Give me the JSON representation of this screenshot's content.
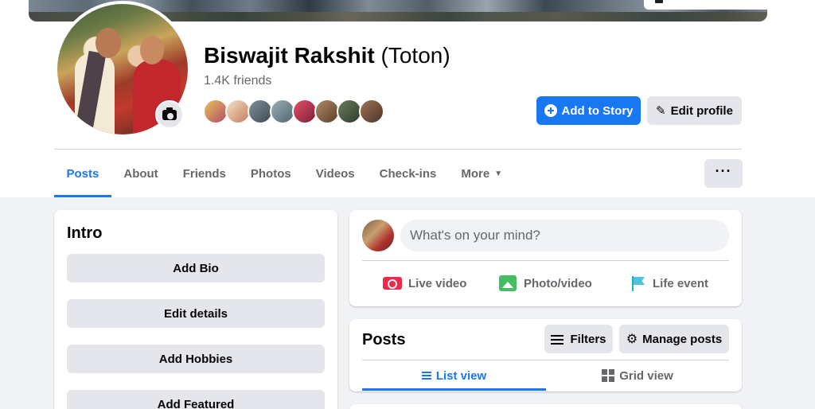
{
  "profile": {
    "name": "Biswajit Rakshit",
    "nickname": "(Toton)",
    "friends_count": "1.4K friends"
  },
  "actions": {
    "add_story": "Add to Story",
    "edit_profile": "Edit profile"
  },
  "tabs": [
    {
      "label": "Posts"
    },
    {
      "label": "About"
    },
    {
      "label": "Friends"
    },
    {
      "label": "Photos"
    },
    {
      "label": "Videos"
    },
    {
      "label": "Check-ins"
    },
    {
      "label": "More"
    }
  ],
  "more_button": "···",
  "intro": {
    "title": "Intro",
    "buttons": [
      "Add Bio",
      "Edit details",
      "Add Hobbies",
      "Add Featured"
    ]
  },
  "composer": {
    "placeholder": "What's on your mind?",
    "actions": [
      "Live video",
      "Photo/video",
      "Life event"
    ]
  },
  "posts": {
    "title": "Posts",
    "filters": "Filters",
    "manage": "Manage posts",
    "views": [
      "List view",
      "Grid view"
    ]
  },
  "colors": {
    "accent": "#1877f2",
    "background": "#f0f2f5",
    "button_gray": "#e4e6eb"
  }
}
